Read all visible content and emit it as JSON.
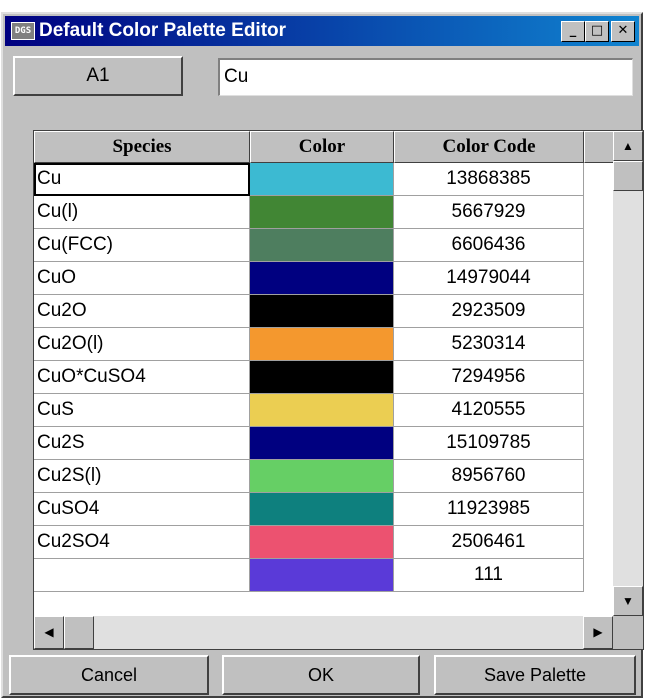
{
  "window": {
    "title": "Default Color Palette Editor",
    "icon": "app-icon",
    "icon_text": "DGS"
  },
  "titlebar_buttons": {
    "minimize": "_",
    "maximize": "□",
    "close": "✕"
  },
  "formula_bar": {
    "cell_ref": "A1",
    "value": "Cu"
  },
  "table": {
    "headers": [
      "Species",
      "Color",
      "Color Code"
    ],
    "rows": [
      {
        "species": "Cu",
        "color": "#3cbad2",
        "code": "13868385"
      },
      {
        "species": "Cu(l)",
        "color": "#418634",
        "code": "5667929"
      },
      {
        "species": "Cu(FCC)",
        "color": "#4e7e5f",
        "code": "6606436"
      },
      {
        "species": "CuO",
        "color": "#000080",
        "code": "14979044"
      },
      {
        "species": "Cu2O",
        "color": "#000000",
        "code": "2923509"
      },
      {
        "species": "Cu2O(l)",
        "color": "#f4982e",
        "code": "5230314"
      },
      {
        "species": "CuO*CuSO4",
        "color": "#000000",
        "code": "7294956"
      },
      {
        "species": "CuS",
        "color": "#ebce52",
        "code": "4120555"
      },
      {
        "species": "Cu2S",
        "color": "#000080",
        "code": "15109785"
      },
      {
        "species": "Cu2S(l)",
        "color": "#66cf65",
        "code": "8956760"
      },
      {
        "species": "CuSO4",
        "color": "#0e807e",
        "code": "11923985"
      },
      {
        "species": "Cu2SO4",
        "color": "#ec5270",
        "code": "2506461"
      },
      {
        "species": "",
        "color": "#5a3ad8",
        "code": "111"
      }
    ]
  },
  "scrollbar": {
    "up": "▲",
    "down": "▼",
    "left": "◀",
    "right": "▶"
  },
  "buttons": {
    "cancel": "Cancel",
    "ok": "OK",
    "save": "Save Palette"
  }
}
